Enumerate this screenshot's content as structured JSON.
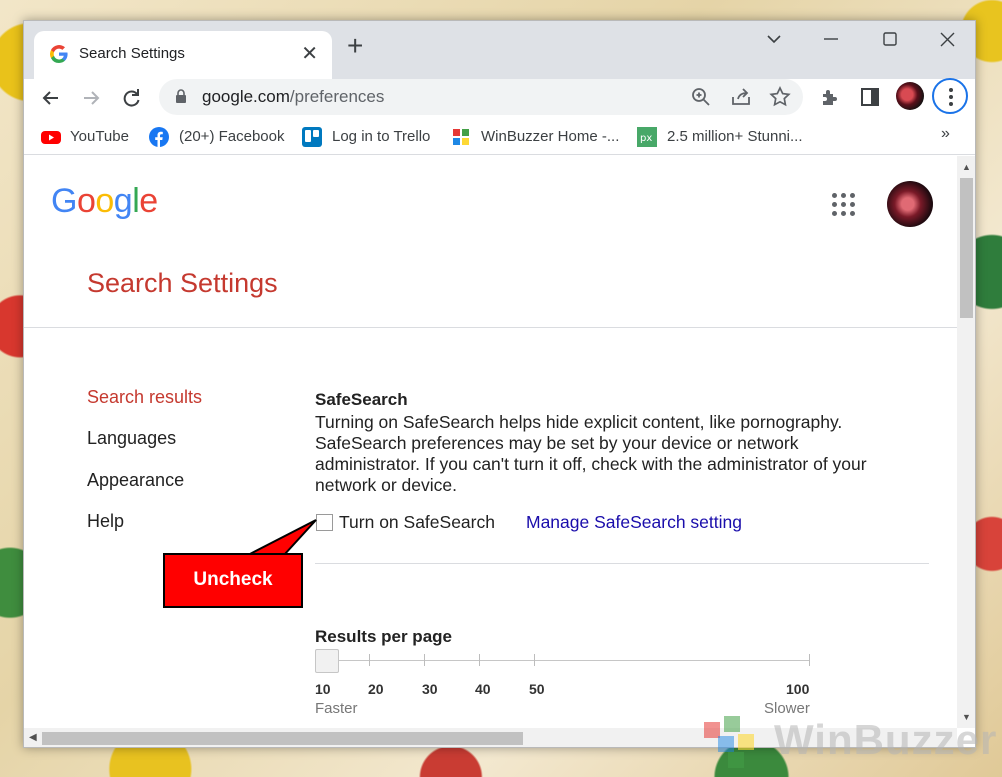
{
  "browser": {
    "tab": {
      "title": "Search Settings"
    },
    "address": {
      "domain": "google.com",
      "path": "/preferences"
    },
    "bookmarks": [
      {
        "label": "YouTube",
        "icon": "youtube-icon"
      },
      {
        "label": "(20+) Facebook",
        "icon": "facebook-icon"
      },
      {
        "label": "Log in to Trello",
        "icon": "trello-icon"
      },
      {
        "label": "WinBuzzer Home -...",
        "icon": "winbuzzer-icon"
      },
      {
        "label": "2.5 million+ Stunni...",
        "icon": "pixabay-icon"
      }
    ],
    "bookmarks_overflow": "»"
  },
  "page": {
    "logo_text": "Google",
    "title": "Search Settings",
    "sidebar": [
      {
        "label": "Search results",
        "active": true
      },
      {
        "label": "Languages",
        "active": false
      },
      {
        "label": "Appearance",
        "active": false
      },
      {
        "label": "Help",
        "active": false
      }
    ],
    "safesearch": {
      "heading": "SafeSearch",
      "description": "Turning on SafeSearch helps hide explicit content, like pornography. SafeSearch preferences may be set by your device or network administrator. If you can't turn it off, check with the administrator of your network or device.",
      "checkbox_label": "Turn on SafeSearch",
      "checked": false,
      "manage_link": "Manage SafeSearch setting"
    },
    "results_per_page": {
      "heading": "Results per page",
      "selected": 10,
      "ticks": [
        "10",
        "20",
        "30",
        "40",
        "50",
        "100"
      ],
      "faster_label": "Faster",
      "slower_label": "Slower"
    }
  },
  "annotation": {
    "callout_text": "Uncheck",
    "color": "#ff0000"
  },
  "watermark": {
    "text": "WinBuzzer"
  },
  "colors": {
    "accent_red": "#c5392f",
    "link_blue": "#1a0dab",
    "focus_blue": "#1a73e8"
  }
}
